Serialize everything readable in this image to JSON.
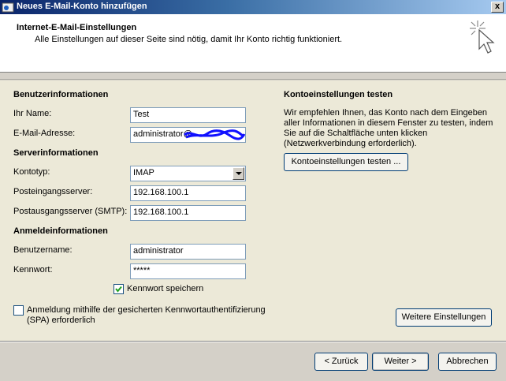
{
  "window": {
    "title": "Neues E-Mail-Konto hinzufügen",
    "close_label": "x"
  },
  "header": {
    "title": "Internet-E-Mail-Einstellungen",
    "subtitle": "Alle Einstellungen auf dieser Seite sind nötig, damit Ihr Konto richtig funktioniert."
  },
  "user_info": {
    "heading": "Benutzerinformationen",
    "name_label": "Ihr Name:",
    "name_value": "Test",
    "email_label": "E-Mail-Adresse:",
    "email_value": "administrator@"
  },
  "server_info": {
    "heading": "Serverinformationen",
    "account_type_label": "Kontotyp:",
    "account_type_value": "IMAP",
    "incoming_label": "Posteingangsserver:",
    "incoming_value": "192.168.100.1",
    "outgoing_label": "Postausgangsserver (SMTP):",
    "outgoing_value": "192.168.100.1"
  },
  "login_info": {
    "heading": "Anmeldeinformationen",
    "username_label": "Benutzername:",
    "username_value": "administrator",
    "password_label": "Kennwort:",
    "password_value": "*****",
    "remember_label": "Kennwort speichern",
    "remember_checked": true,
    "spa_label_line1": "Anmeldung mithilfe der gesicherten Kennwortauthentifizierung",
    "spa_label_line2": "(SPA) erforderlich",
    "spa_checked": false
  },
  "test_settings": {
    "heading": "Kontoeinstellungen testen",
    "description_line1": "Wir empfehlen Ihnen, das Konto nach dem Eingeben",
    "description_line2": "aller Informationen in diesem Fenster zu testen, indem",
    "description_line3": "Sie auf die Schaltfläche unten klicken",
    "description_line4": "(Netzwerkverbindung erforderlich).",
    "test_button": "Kontoeinstellungen testen ...",
    "more_settings_button": "Weitere Einstellungen"
  },
  "footer": {
    "back_button": "< Zurück",
    "next_button": "Weiter >",
    "cancel_button": "Abbrechen"
  },
  "colors": {
    "title_start": "#0a246a",
    "title_end": "#a6caf0",
    "body": "#ece9d8",
    "scribble": "#1010ff"
  }
}
